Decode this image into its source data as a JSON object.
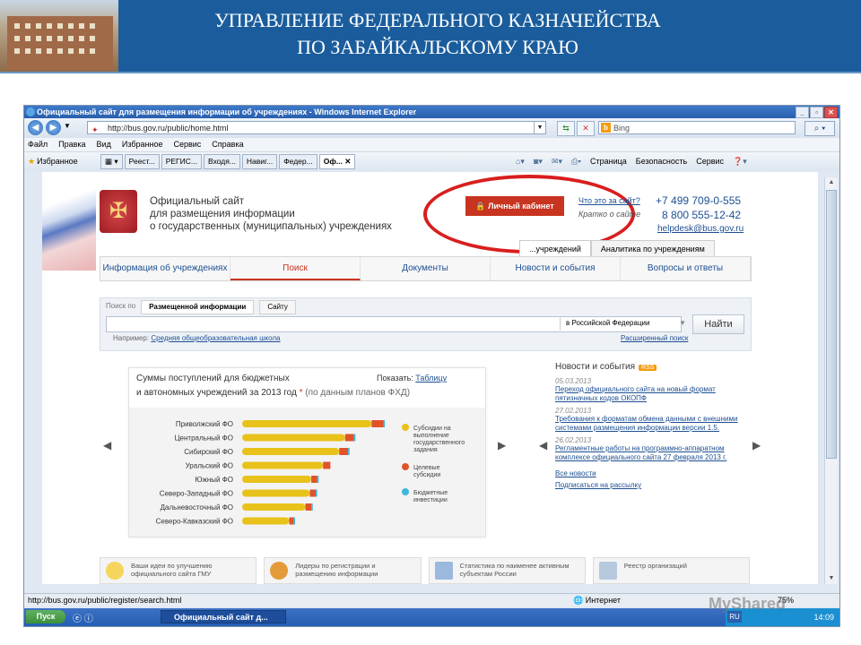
{
  "slide": {
    "title_line1": "УПРАВЛЕНИЕ ФЕДЕРАЛЬНОГО КАЗНАЧЕЙСТВА",
    "title_line2": "ПО ЗАБАЙКАЛЬСКОМУ КРАЮ"
  },
  "browser": {
    "window_title": "Официальный сайт для размещения информации об учреждениях - Windows Internet Explorer",
    "address": "http://bus.gov.ru/public/home.html",
    "search_placeholder": "Bing",
    "menu": [
      "Файл",
      "Правка",
      "Вид",
      "Избранное",
      "Сервис",
      "Справка"
    ],
    "favorites_label": "Избранное",
    "tabs": [
      "Реест...",
      "РЕГИС...",
      "Входя...",
      "Навиг...",
      "Федер...",
      "Оф..."
    ],
    "commands": [
      "Страница",
      "Безопасность",
      "Сервис"
    ],
    "status_url": "http://bus.gov.ru/public/register/search.html",
    "status_zone": "Интернет",
    "zoom": "75%"
  },
  "site": {
    "title_lines": [
      "Официальный сайт",
      "для размещения информации",
      "о государственных (муниципальных) учреждениях"
    ],
    "cabinet_button": "Личный кабинет",
    "what_is": "Что это за сайт?",
    "short_about": "Кратко о сайте",
    "phone1": "+7 499 709-0-555",
    "phone2": "8 800 555-12-42",
    "email": "helpdesk@bus.gov.ru",
    "subtabs": [
      "...учреждений",
      "Аналитика по учреждениям"
    ],
    "nav": [
      "Информация об учреждениях",
      "Поиск",
      "Документы",
      "Новости и события",
      "Вопросы и ответы"
    ],
    "search_by_label": "Поиск по",
    "search_by": [
      "Размещенной информации",
      "Сайту"
    ],
    "scope": "в Российской Федерации",
    "find_button": "Найти",
    "example_prefix": "Например:",
    "example_link": "Средняя общеобразовательная школа",
    "advanced_search": "Расширенный поиск",
    "chart_title_1": "Суммы поступлений для бюджетных",
    "chart_title_2": "и автономных учреждений за 2013 год",
    "chart_title_star": "*",
    "chart_title_note": "(по данным планов ФХД)",
    "show_label": "Показать:",
    "show_link": "Таблицу",
    "news_heading": "Новости и события",
    "rss": "RSS",
    "news": [
      {
        "date": "05.03.2013",
        "text": "Переход официального сайта на новый формат пятизначных кодов ОКОПФ"
      },
      {
        "date": "27.02.2013",
        "text": "Требования к форматам обмена данными с внешними системами размещения информации версии 1.5."
      },
      {
        "date": "26.02.2013",
        "text": "Регламентные работы на программно-аппаратном комплексе официального сайта 27 февраля 2013 г."
      }
    ],
    "all_news": "Все новости",
    "subscribe": "Подписаться на рассылку",
    "tiles": [
      "Ваши идеи по улучшению официального сайта ГМУ",
      "Лидеры по регистрации и размещению информации",
      "Статистика по наименее активным субъектам России",
      "Реестр организаций"
    ]
  },
  "taskbar": {
    "start": "Пуск",
    "active_window": "Официальный сайт д...",
    "lang": "RU",
    "clock": "14:09"
  },
  "watermark": "MyShared",
  "chart_data": {
    "type": "bar",
    "orientation": "horizontal",
    "stacked": true,
    "categories": [
      "Приволжский ФО",
      "Центральный ФО",
      "Сибирский ФО",
      "Уральский ФО",
      "Южный ФО",
      "Северо-Западный ФО",
      "Дальневосточный ФО",
      "Северо-Кавказский ФО"
    ],
    "series": [
      {
        "name": "Субсидии на выполнение государственного задания",
        "color": "#e8c21b",
        "values": [
          88,
          70,
          66,
          55,
          47,
          46,
          43,
          32
        ]
      },
      {
        "name": "Целевые субсидии",
        "color": "#e0532b",
        "values": [
          8,
          6,
          6,
          5,
          4,
          4,
          4,
          3
        ]
      },
      {
        "name": "Бюджетные инвестиции",
        "color": "#3fb8d8",
        "values": [
          1,
          1,
          1,
          0,
          1,
          1,
          1,
          1
        ]
      }
    ],
    "xlim": [
      0,
      100
    ],
    "legend": "right"
  }
}
